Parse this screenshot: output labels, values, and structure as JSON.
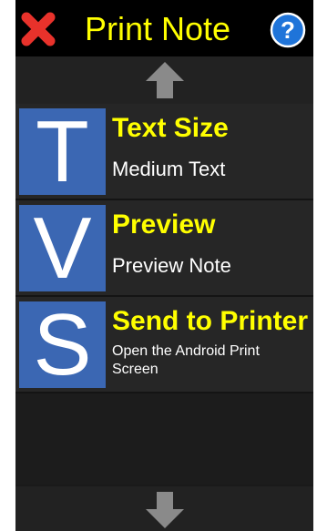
{
  "app": {
    "title": "Print Note",
    "close_icon": "close-x-icon",
    "help_icon": "help-question-icon"
  },
  "scroll": {
    "up_icon": "arrow-up-icon",
    "down_icon": "arrow-down-icon"
  },
  "items": [
    {
      "letter": "T",
      "title": "Text Size",
      "subtitle": "Medium Text"
    },
    {
      "letter": "V",
      "title": "Preview",
      "subtitle": "Preview Note"
    },
    {
      "letter": "S",
      "title": "Send to Printer",
      "subtitle": "Open the Android Print Screen"
    }
  ],
  "colors": {
    "accent": "#ffff00",
    "tile": "#3b67b3",
    "close": "#e8322b",
    "help": "#1f74d9",
    "arrow": "#8a8a8a"
  }
}
